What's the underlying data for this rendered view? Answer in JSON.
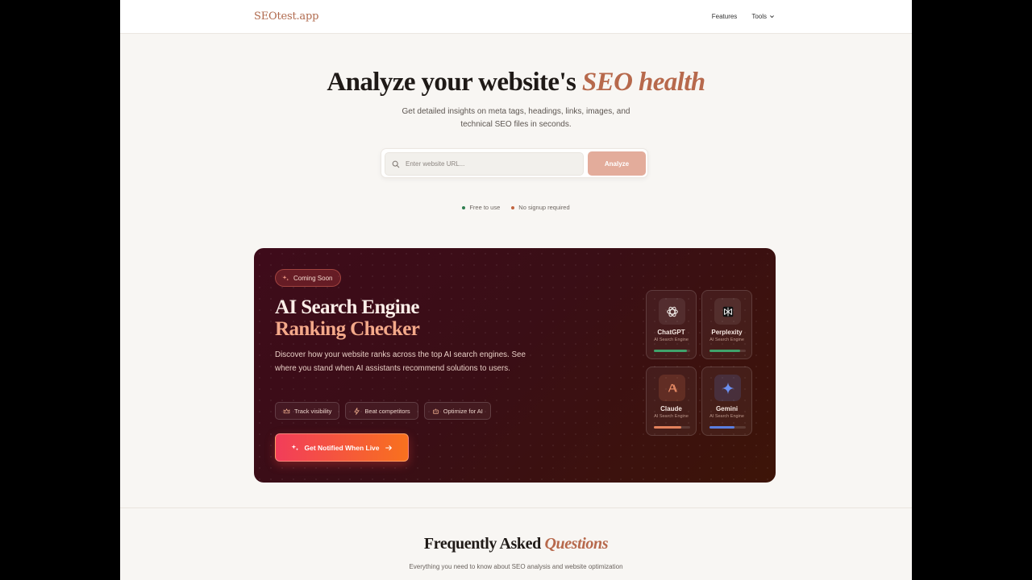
{
  "header": {
    "logo": "SEOtest.app",
    "nav": {
      "features": "Features",
      "tools": "Tools"
    }
  },
  "hero": {
    "title_plain": "Analyze your website's ",
    "title_accent": "SEO health",
    "subtitle": "Get detailed insights on meta tags, headings, links, images, and technical SEO files in seconds.",
    "search_placeholder": "Enter website URL...",
    "analyze_label": "Analyze",
    "perks": [
      {
        "label": "Free to use",
        "color": "#2e7d4f"
      },
      {
        "label": "No signup required",
        "color": "#c0643f"
      }
    ]
  },
  "ai_banner": {
    "badge": "Coming Soon",
    "title_line1": "AI Search Engine",
    "title_line2": "Ranking Checker",
    "description": "Discover how your website ranks across the top AI search engines. See where you stand when AI assistants recommend solutions to users.",
    "features": [
      {
        "label": "Track visibility",
        "icon": "crown-icon"
      },
      {
        "label": "Beat competitors",
        "icon": "bolt-icon"
      },
      {
        "label": "Optimize for AI",
        "icon": "robot-icon"
      }
    ],
    "cta_label": "Get Notified When Live",
    "engines": [
      {
        "name": "ChatGPT",
        "type": "AI Search Engine",
        "progress": 0.9,
        "bar_color": "#3fa36b",
        "icon": "openai-icon"
      },
      {
        "name": "Perplexity",
        "type": "AI Search Engine",
        "progress": 0.85,
        "bar_color": "#3fa36b",
        "icon": "perplexity-icon"
      },
      {
        "name": "Claude",
        "type": "AI Search Engine",
        "progress": 0.75,
        "bar_color": "#e3825c",
        "icon": "claude-icon"
      },
      {
        "name": "Gemini",
        "type": "AI Search Engine",
        "progress": 0.68,
        "bar_color": "#5a7ee0",
        "icon": "gemini-icon"
      }
    ]
  },
  "faq": {
    "title_plain": "Frequently Asked ",
    "title_accent": "Questions",
    "subtitle": "Everything you need to know about SEO analysis and website optimization"
  }
}
